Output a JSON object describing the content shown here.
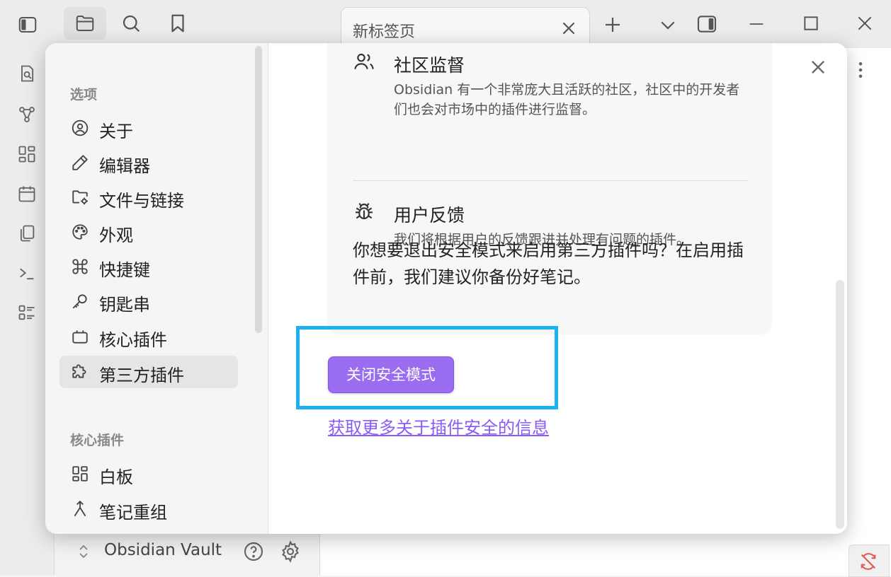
{
  "window": {
    "tab_title": "新标签页"
  },
  "left_pane": {
    "vault_name": "Obsidian Vault"
  },
  "settings": {
    "sidebar": {
      "options_header": "选项",
      "options": [
        {
          "label": "关于",
          "icon": "user-circle-icon"
        },
        {
          "label": "编辑器",
          "icon": "pencil-icon"
        },
        {
          "label": "文件与链接",
          "icon": "folder-cog-icon"
        },
        {
          "label": "外观",
          "icon": "palette-icon"
        },
        {
          "label": "快捷键",
          "icon": "command-icon"
        },
        {
          "label": "钥匙串",
          "icon": "key-icon"
        },
        {
          "label": "核心插件",
          "icon": "plug-icon"
        },
        {
          "label": "第三方插件",
          "icon": "puzzle-icon"
        }
      ],
      "active_item": "第三方插件",
      "core_plugins_header": "核心插件",
      "core_plugins": [
        {
          "label": "白板",
          "icon": "layout-grid-icon"
        },
        {
          "label": "笔记重组",
          "icon": "merge-icon"
        }
      ]
    },
    "content": {
      "features": [
        {
          "title": "社区监督",
          "desc": "Obsidian 有一个非常庞大且活跃的社区，社区中的开发者们也会对市场中的插件进行监督。",
          "icon": "users-icon"
        },
        {
          "title": "用户反馈",
          "desc": "我们将根据用户的反馈跟进并处理有问题的插件。",
          "icon": "bug-icon"
        }
      ],
      "question": "你想要退出安全模式来启用第三方插件吗？在启用插件前，我们建议你备份好笔记。",
      "exit_button": "关闭安全模式",
      "learn_more_link": "获取更多关于插件安全的信息"
    }
  },
  "colors": {
    "accent": "#9a6cf0",
    "highlight_box": "#1ab2f0",
    "link": "#8a5cf5"
  }
}
